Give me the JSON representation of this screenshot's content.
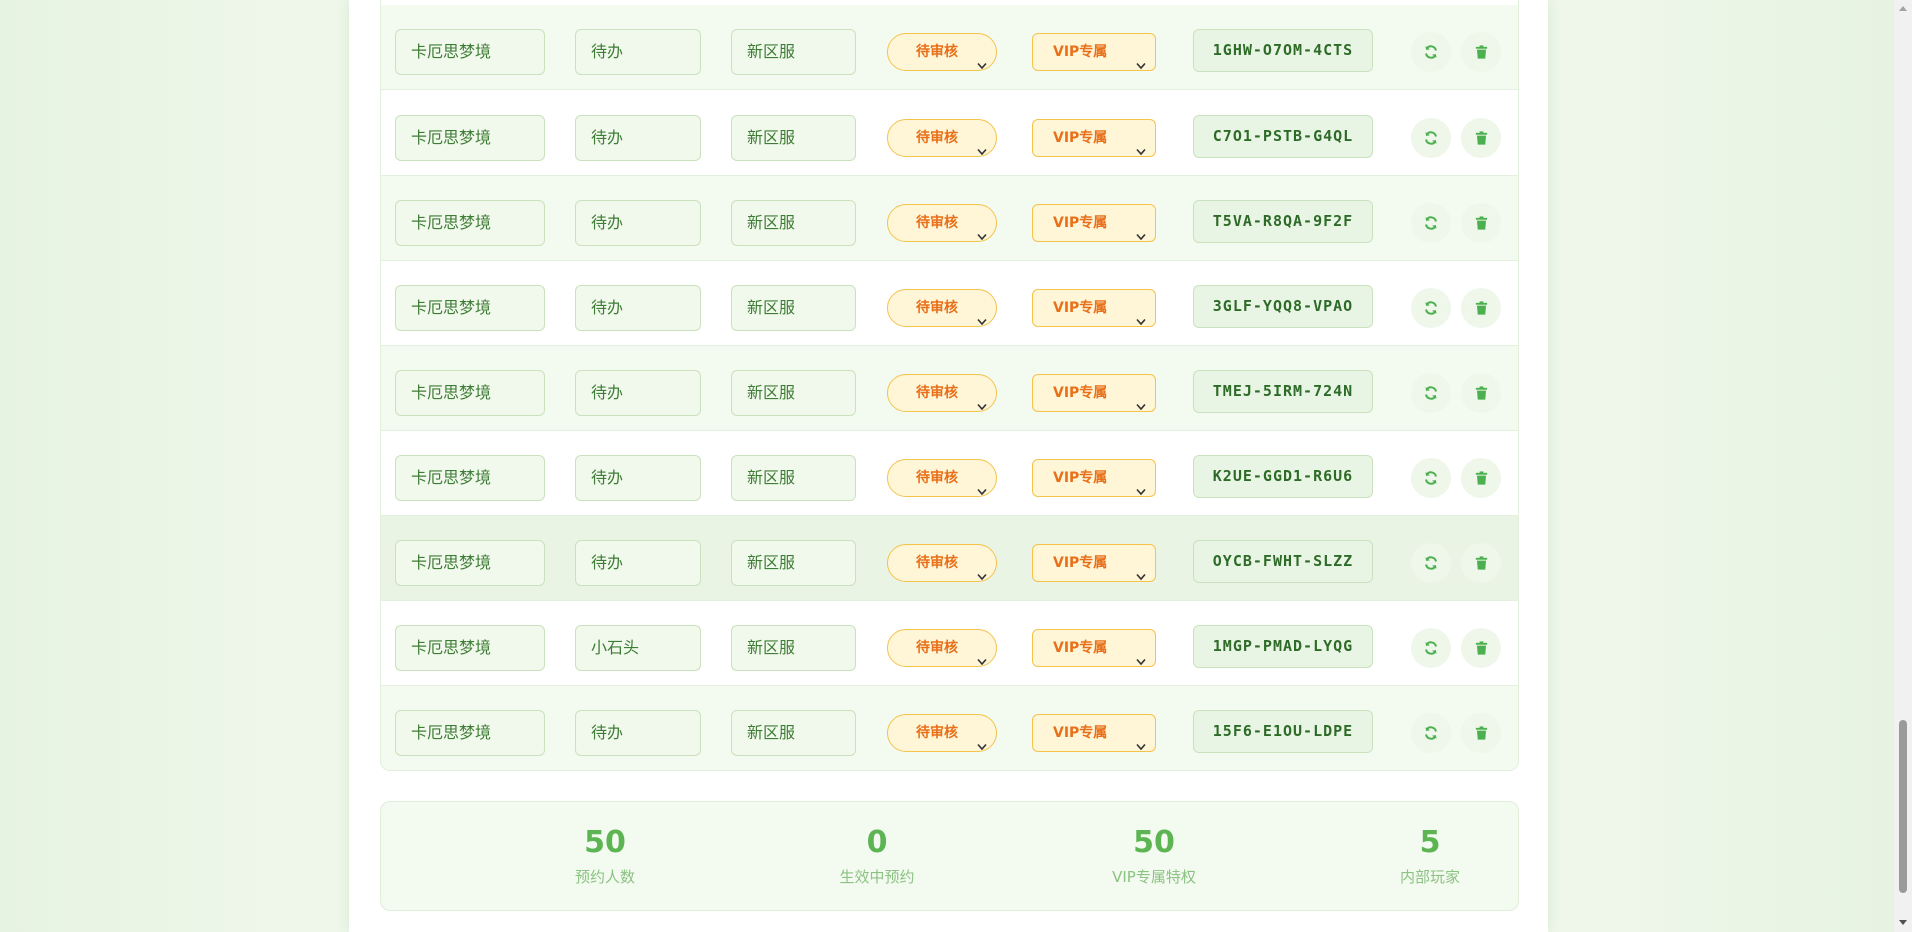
{
  "colors": {
    "accent": "#5cb552",
    "text_green": "#3e7d35",
    "warning_orange": "#e8701a",
    "warning_border": "#f4c34c",
    "delete_green": "#4caf50"
  },
  "rows": [
    {
      "game": "卡厄思梦境",
      "name": "待办",
      "server": "新区服",
      "status": "待审核",
      "tier": "VIP专属",
      "code": "1GHW-O7OM-4CTS"
    },
    {
      "game": "卡厄思梦境",
      "name": "待办",
      "server": "新区服",
      "status": "待审核",
      "tier": "VIP专属",
      "code": "C7O1-PSTB-G4QL"
    },
    {
      "game": "卡厄思梦境",
      "name": "待办",
      "server": "新区服",
      "status": "待审核",
      "tier": "VIP专属",
      "code": "T5VA-R8QA-9F2F"
    },
    {
      "game": "卡厄思梦境",
      "name": "待办",
      "server": "新区服",
      "status": "待审核",
      "tier": "VIP专属",
      "code": "3GLF-YQQ8-VPAO"
    },
    {
      "game": "卡厄思梦境",
      "name": "待办",
      "server": "新区服",
      "status": "待审核",
      "tier": "VIP专属",
      "code": "TMEJ-5IRM-724N"
    },
    {
      "game": "卡厄思梦境",
      "name": "待办",
      "server": "新区服",
      "status": "待审核",
      "tier": "VIP专属",
      "code": "K2UE-GGD1-R6U6"
    },
    {
      "game": "卡厄思梦境",
      "name": "待办",
      "server": "新区服",
      "status": "待审核",
      "tier": "VIP专属",
      "code": "OYCB-FWHT-SLZZ"
    },
    {
      "game": "卡厄思梦境",
      "name": "小石头",
      "server": "新区服",
      "status": "待审核",
      "tier": "VIP专属",
      "code": "1MGP-PMAD-LYQG"
    },
    {
      "game": "卡厄思梦境",
      "name": "待办",
      "server": "新区服",
      "status": "待审核",
      "tier": "VIP专属",
      "code": "15F6-E1OU-LDPE"
    }
  ],
  "row_icons": {
    "refresh": "refresh-icon",
    "delete": "trash-icon"
  },
  "stats": [
    {
      "value": "50",
      "label": "预约人数"
    },
    {
      "value": "0",
      "label": "生效中预约"
    },
    {
      "value": "50",
      "label": "VIP专属特权"
    },
    {
      "value": "5",
      "label": "内部玩家"
    }
  ]
}
